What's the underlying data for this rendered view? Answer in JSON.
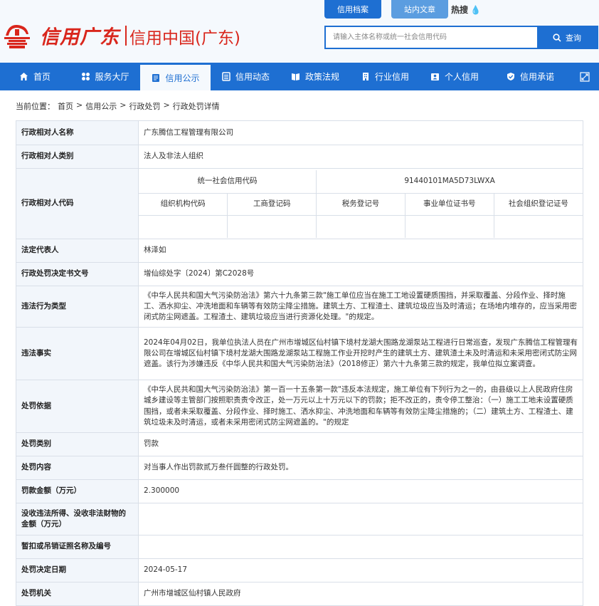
{
  "header": {
    "logo_script": "信用广东",
    "logo_title": "信用中国(广东)",
    "top_tabs": [
      "信用档案",
      "站内文章"
    ],
    "hot_search": "热搜",
    "search_placeholder": "请输入主体名称或统一社会信用代码",
    "search_button": "查询"
  },
  "nav": [
    {
      "label": "首页",
      "icon": "home-icon"
    },
    {
      "label": "服务大厅",
      "icon": "grid-icon"
    },
    {
      "label": "信用公示",
      "icon": "document-icon"
    },
    {
      "label": "信用动态",
      "icon": "list-icon"
    },
    {
      "label": "政策法规",
      "icon": "book-icon"
    },
    {
      "label": "行业信用",
      "icon": "building-icon"
    },
    {
      "label": "个人信用",
      "icon": "id-card-icon"
    },
    {
      "label": "信用承诺",
      "icon": "shield-icon"
    }
  ],
  "breadcrumb": {
    "prefix": "当前位置：",
    "items": [
      "首页",
      "信用公示",
      "行政处罚",
      "行政处罚详情"
    ],
    "sep": ">"
  },
  "detail": {
    "name_label": "行政相对人名称",
    "name_value": "广东腾信工程管理有限公司",
    "type_label": "行政相对人类别",
    "type_value": "法人及非法人组织",
    "code_label": "行政相对人代码",
    "uscc_label": "统一社会信用代码",
    "uscc_value": "91440101MA5D73LWXA",
    "code_headers": [
      "组织机构代码",
      "工商登记码",
      "税务登记号",
      "事业单位证书号",
      "社会组织登记证号"
    ],
    "legal_label": "法定代表人",
    "legal_value": "林泽如",
    "docno_label": "行政处罚决定书文号",
    "docno_value": "增仙综处字〔2024〕第C2028号",
    "violation_type_label": "违法行为类型",
    "violation_type_value": "《中华人民共和国大气污染防治法》第六十九条第三款\"施工单位应当在施工工地设置硬质围挡，并采取覆盖、分段作业、择时施工、洒水抑尘、冲洗地面和车辆等有效防尘降尘措施。建筑土方、工程渣土、建筑垃圾应当及时清运；在场地内堆存的，应当采用密闭式防尘网遮盖。工程渣土、建筑垃圾应当进行资源化处理。\"的规定。",
    "facts_label": "违法事实",
    "facts_value": "2024年04月02日，我单位执法人员在广州市增城区仙村镇下境村龙湖大围路龙湖泵站工程进行日常巡查，发现广东腾信工程管理有限公司在增城区仙村镇下境村龙湖大围路龙湖泵站工程施工作业开挖时产生的建筑土方、建筑渣土未及时清运和未采用密闭式防尘网遮盖。该行为涉嫌违反《中华人民共和国大气污染防治法》（2018修正）第六十九条第三款的规定，我单位拟立案调查。",
    "basis_label": "处罚依据",
    "basis_value": "《中华人民共和国大气污染防治法》第一百一十五条第一款\"违反本法规定，施工单位有下列行为之一的，由县级以上人民政府住房城乡建设等主管部门按照职责责令改正，处一万元以上十万元以下的罚款；拒不改正的，责令停工整治：（一）施工工地未设置硬质围挡，或者未采取覆盖、分段作业、择时施工、洒水抑尘、冲洗地面和车辆等有效防尘降尘措施的；（二）建筑土方、工程渣土、建筑垃圾未及时清运，或者未采用密闭式防尘网遮盖的。\"的规定",
    "category_label": "处罚类别",
    "category_value": "罚款",
    "content_label": "处罚内容",
    "content_value": "对当事人作出罚款贰万叁仟圆整的行政处罚。",
    "amount_label": "罚款金额（万元）",
    "amount_value": "2.300000",
    "confiscate_label": "没收违法所得、没收非法财物的金额（万元）",
    "confiscate_value": "",
    "revoke_label": "暂扣或吊销证照名称及编号",
    "revoke_value": "",
    "date_label": "处罚决定日期",
    "date_value": "2024-05-17",
    "org_label": "处罚机关",
    "org_value": "广州市增城区仙村镇人民政府"
  },
  "colors": {
    "brand_red": "#d9261c",
    "nav_blue": "#1e6fd2",
    "label_bg": "#f2f6fb"
  }
}
